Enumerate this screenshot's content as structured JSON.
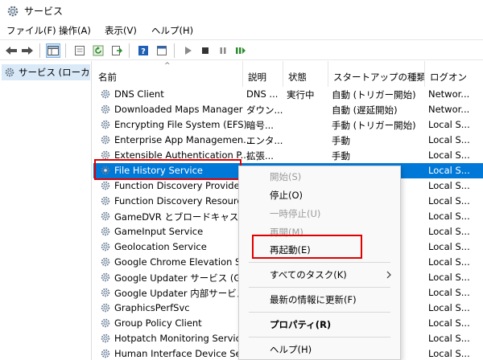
{
  "window": {
    "title": "サービス"
  },
  "menu": [
    "ファイル(F)",
    "操作(A)",
    "表示(V)",
    "ヘルプ(H)"
  ],
  "tree": {
    "node_label": "サービス (ローカル)"
  },
  "columns": {
    "name": "名前",
    "description": "説明",
    "status": "状態",
    "startup": "スタートアップの種類",
    "logon": "ログオン"
  },
  "services": [
    {
      "name": "DNS Client",
      "description": "DNS ...",
      "status": "実行中",
      "startup": "自動 (トリガー開始)",
      "logon": "Networ..."
    },
    {
      "name": "Downloaded Maps Manager",
      "description": "ダウン...",
      "status": "",
      "startup": "自動 (遅延開始)",
      "logon": "Networ..."
    },
    {
      "name": "Encrypting File System (EFS)",
      "description": "暗号...",
      "status": "",
      "startup": "手動 (トリガー開始)",
      "logon": "Local S..."
    },
    {
      "name": "Enterprise App Managemen...",
      "description": "エンタ...",
      "status": "",
      "startup": "手動",
      "logon": "Local S..."
    },
    {
      "name": "Extensible Authentication P...",
      "description": "拡張...",
      "status": "",
      "startup": "手動",
      "logon": "Local S..."
    },
    {
      "name": "File History Service",
      "description": "",
      "status": "",
      "startup": "",
      "logon": "Local S..."
    },
    {
      "name": "Function Discovery Provider...",
      "description": "",
      "status": "",
      "startup": "",
      "logon": "Local S..."
    },
    {
      "name": "Function Discovery Resourc...",
      "description": "",
      "status": "",
      "startup": "",
      "logon": "Local S..."
    },
    {
      "name": "GameDVR とブロードキャスト ユ...",
      "description": "",
      "status": "",
      "startup": "",
      "logon": "Local S..."
    },
    {
      "name": "GameInput Service",
      "description": "",
      "status": "",
      "startup": "",
      "logon": "Local S..."
    },
    {
      "name": "Geolocation Service",
      "description": "",
      "status": "",
      "startup": "",
      "logon": "Local S..."
    },
    {
      "name": "Google Chrome Elevation S...",
      "description": "",
      "status": "",
      "startup": "",
      "logon": "Local S..."
    },
    {
      "name": "Google Updater サービス (Go...",
      "description": "",
      "status": "",
      "startup": "",
      "logon": "Local S..."
    },
    {
      "name": "Google Updater 内部サービス...",
      "description": "",
      "status": "",
      "startup": "",
      "logon": "Local S..."
    },
    {
      "name": "GraphicsPerfSvc",
      "description": "",
      "status": "",
      "startup": "",
      "logon": "Local S..."
    },
    {
      "name": "Group Policy Client",
      "description": "",
      "status": "",
      "startup": "",
      "logon": "Local S..."
    },
    {
      "name": "Hotpatch Monitoring Service",
      "description": "",
      "status": "",
      "startup": "",
      "logon": "Local S..."
    },
    {
      "name": "Human Interface Device Ser...",
      "description": "",
      "status": "",
      "startup": "",
      "logon": "Local S..."
    }
  ],
  "context_menu": [
    {
      "label": "開始(S)",
      "disabled": true
    },
    {
      "label": "停止(O)",
      "disabled": false
    },
    {
      "label": "一時停止(U)",
      "disabled": true
    },
    {
      "label": "再開(M)",
      "disabled": true
    },
    {
      "label": "再起動(E)",
      "disabled": false
    },
    {
      "label": "すべてのタスク(K)",
      "disabled": false,
      "submenu": true
    },
    {
      "label": "最新の情報に更新(F)",
      "disabled": false
    },
    {
      "label": "プロパティ(R)",
      "disabled": false,
      "bold": true
    },
    {
      "label": "ヘルプ(H)",
      "disabled": false
    }
  ],
  "colors": {
    "selection": "#0078d7",
    "highlight_border": "#e00000"
  }
}
